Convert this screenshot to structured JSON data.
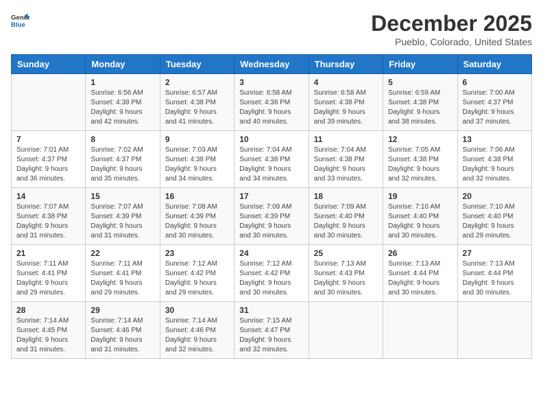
{
  "header": {
    "logo_general": "General",
    "logo_blue": "Blue",
    "title": "December 2025",
    "subtitle": "Pueblo, Colorado, United States"
  },
  "calendar": {
    "days_of_week": [
      "Sunday",
      "Monday",
      "Tuesday",
      "Wednesday",
      "Thursday",
      "Friday",
      "Saturday"
    ],
    "weeks": [
      [
        {
          "day": "",
          "sunrise": "",
          "sunset": "",
          "daylight": ""
        },
        {
          "day": "1",
          "sunrise": "6:56 AM",
          "sunset": "4:38 PM",
          "daylight": "9 hours and 42 minutes."
        },
        {
          "day": "2",
          "sunrise": "6:57 AM",
          "sunset": "4:38 PM",
          "daylight": "9 hours and 41 minutes."
        },
        {
          "day": "3",
          "sunrise": "6:58 AM",
          "sunset": "4:38 PM",
          "daylight": "9 hours and 40 minutes."
        },
        {
          "day": "4",
          "sunrise": "6:58 AM",
          "sunset": "4:38 PM",
          "daylight": "9 hours and 39 minutes."
        },
        {
          "day": "5",
          "sunrise": "6:59 AM",
          "sunset": "4:38 PM",
          "daylight": "9 hours and 38 minutes."
        },
        {
          "day": "6",
          "sunrise": "7:00 AM",
          "sunset": "4:37 PM",
          "daylight": "9 hours and 37 minutes."
        }
      ],
      [
        {
          "day": "7",
          "sunrise": "7:01 AM",
          "sunset": "4:37 PM",
          "daylight": "9 hours and 36 minutes."
        },
        {
          "day": "8",
          "sunrise": "7:02 AM",
          "sunset": "4:37 PM",
          "daylight": "9 hours and 35 minutes."
        },
        {
          "day": "9",
          "sunrise": "7:03 AM",
          "sunset": "4:38 PM",
          "daylight": "9 hours and 34 minutes."
        },
        {
          "day": "10",
          "sunrise": "7:04 AM",
          "sunset": "4:38 PM",
          "daylight": "9 hours and 34 minutes."
        },
        {
          "day": "11",
          "sunrise": "7:04 AM",
          "sunset": "4:38 PM",
          "daylight": "9 hours and 33 minutes."
        },
        {
          "day": "12",
          "sunrise": "7:05 AM",
          "sunset": "4:38 PM",
          "daylight": "9 hours and 32 minutes."
        },
        {
          "day": "13",
          "sunrise": "7:06 AM",
          "sunset": "4:38 PM",
          "daylight": "9 hours and 32 minutes."
        }
      ],
      [
        {
          "day": "14",
          "sunrise": "7:07 AM",
          "sunset": "4:38 PM",
          "daylight": "9 hours and 31 minutes."
        },
        {
          "day": "15",
          "sunrise": "7:07 AM",
          "sunset": "4:39 PM",
          "daylight": "9 hours and 31 minutes."
        },
        {
          "day": "16",
          "sunrise": "7:08 AM",
          "sunset": "4:39 PM",
          "daylight": "9 hours and 30 minutes."
        },
        {
          "day": "17",
          "sunrise": "7:09 AM",
          "sunset": "4:39 PM",
          "daylight": "9 hours and 30 minutes."
        },
        {
          "day": "18",
          "sunrise": "7:09 AM",
          "sunset": "4:40 PM",
          "daylight": "9 hours and 30 minutes."
        },
        {
          "day": "19",
          "sunrise": "7:10 AM",
          "sunset": "4:40 PM",
          "daylight": "9 hours and 30 minutes."
        },
        {
          "day": "20",
          "sunrise": "7:10 AM",
          "sunset": "4:40 PM",
          "daylight": "9 hours and 29 minutes."
        }
      ],
      [
        {
          "day": "21",
          "sunrise": "7:11 AM",
          "sunset": "4:41 PM",
          "daylight": "9 hours and 29 minutes."
        },
        {
          "day": "22",
          "sunrise": "7:11 AM",
          "sunset": "4:41 PM",
          "daylight": "9 hours and 29 minutes."
        },
        {
          "day": "23",
          "sunrise": "7:12 AM",
          "sunset": "4:42 PM",
          "daylight": "9 hours and 29 minutes."
        },
        {
          "day": "24",
          "sunrise": "7:12 AM",
          "sunset": "4:42 PM",
          "daylight": "9 hours and 30 minutes."
        },
        {
          "day": "25",
          "sunrise": "7:13 AM",
          "sunset": "4:43 PM",
          "daylight": "9 hours and 30 minutes."
        },
        {
          "day": "26",
          "sunrise": "7:13 AM",
          "sunset": "4:44 PM",
          "daylight": "9 hours and 30 minutes."
        },
        {
          "day": "27",
          "sunrise": "7:13 AM",
          "sunset": "4:44 PM",
          "daylight": "9 hours and 30 minutes."
        }
      ],
      [
        {
          "day": "28",
          "sunrise": "7:14 AM",
          "sunset": "4:45 PM",
          "daylight": "9 hours and 31 minutes."
        },
        {
          "day": "29",
          "sunrise": "7:14 AM",
          "sunset": "4:46 PM",
          "daylight": "9 hours and 31 minutes."
        },
        {
          "day": "30",
          "sunrise": "7:14 AM",
          "sunset": "4:46 PM",
          "daylight": "9 hours and 32 minutes."
        },
        {
          "day": "31",
          "sunrise": "7:15 AM",
          "sunset": "4:47 PM",
          "daylight": "9 hours and 32 minutes."
        },
        {
          "day": "",
          "sunrise": "",
          "sunset": "",
          "daylight": ""
        },
        {
          "day": "",
          "sunrise": "",
          "sunset": "",
          "daylight": ""
        },
        {
          "day": "",
          "sunrise": "",
          "sunset": "",
          "daylight": ""
        }
      ]
    ],
    "labels": {
      "sunrise": "Sunrise:",
      "sunset": "Sunset:",
      "daylight": "Daylight:"
    }
  }
}
